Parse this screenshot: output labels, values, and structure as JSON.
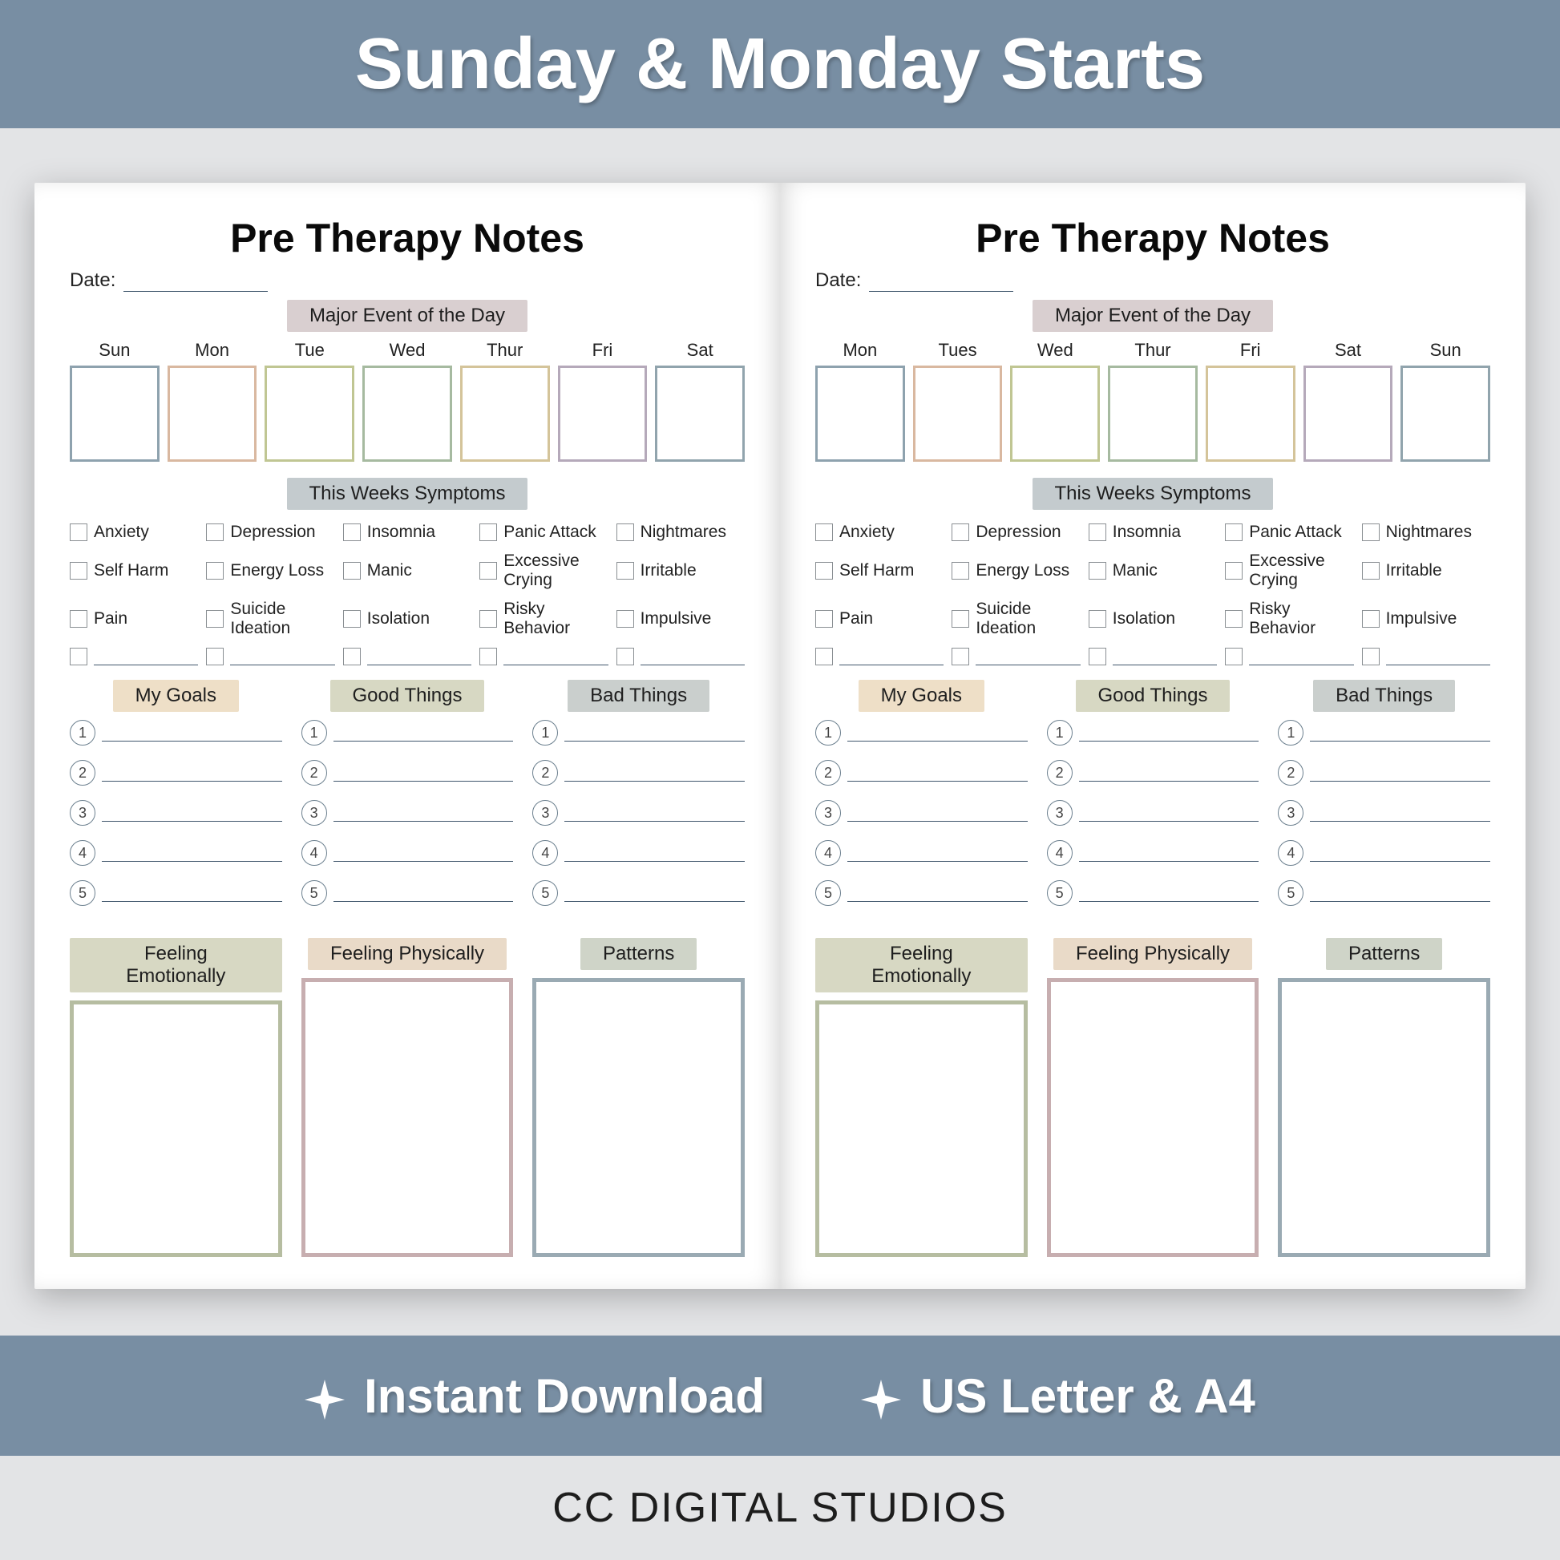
{
  "banner_top": "Sunday & Monday Starts",
  "banner_bottom": {
    "item1": "Instant Download",
    "item2": "US Letter & A4"
  },
  "footer_brand": "CC DIGITAL STUDIOS",
  "page_left": {
    "title": "Pre Therapy Notes",
    "date_label": "Date:",
    "major_event_label": "Major Event of the Day",
    "days": [
      "Sun",
      "Mon",
      "Tue",
      "Wed",
      "Thur",
      "Fri",
      "Sat"
    ],
    "symptoms_label": "This Weeks Symptoms",
    "symptoms": [
      "Anxiety",
      "Depression",
      "Insomnia",
      "Panic Attack",
      "Nightmares",
      "Self Harm",
      "Energy Loss",
      "Manic",
      "Excessive Crying",
      "Irritable",
      "Pain",
      "Suicide Ideation",
      "Isolation",
      "Risky Behavior",
      "Impulsive"
    ],
    "goals_label": "My Goals",
    "good_label": "Good Things",
    "bad_label": "Bad Things",
    "numbers": [
      "1",
      "2",
      "3",
      "4",
      "5"
    ],
    "emo_label": "Feeling Emotionally",
    "phys_label": "Feeling Physically",
    "patt_label": "Patterns"
  },
  "page_right": {
    "title": "Pre Therapy Notes",
    "date_label": "Date:",
    "major_event_label": "Major Event of the Day",
    "days": [
      "Mon",
      "Tues",
      "Wed",
      "Thur",
      "Fri",
      "Sat",
      "Sun"
    ],
    "symptoms_label": "This Weeks Symptoms",
    "symptoms": [
      "Anxiety",
      "Depression",
      "Insomnia",
      "Panic Attack",
      "Nightmares",
      "Self Harm",
      "Energy Loss",
      "Manic",
      "Excessive Crying",
      "Irritable",
      "Pain",
      "Suicide Ideation",
      "Isolation",
      "Risky Behavior",
      "Impulsive"
    ],
    "goals_label": "My Goals",
    "good_label": "Good Things",
    "bad_label": "Bad Things",
    "numbers": [
      "1",
      "2",
      "3",
      "4",
      "5"
    ],
    "emo_label": "Feeling Emotionally",
    "phys_label": "Feeling Physically",
    "patt_label": "Patterns"
  }
}
